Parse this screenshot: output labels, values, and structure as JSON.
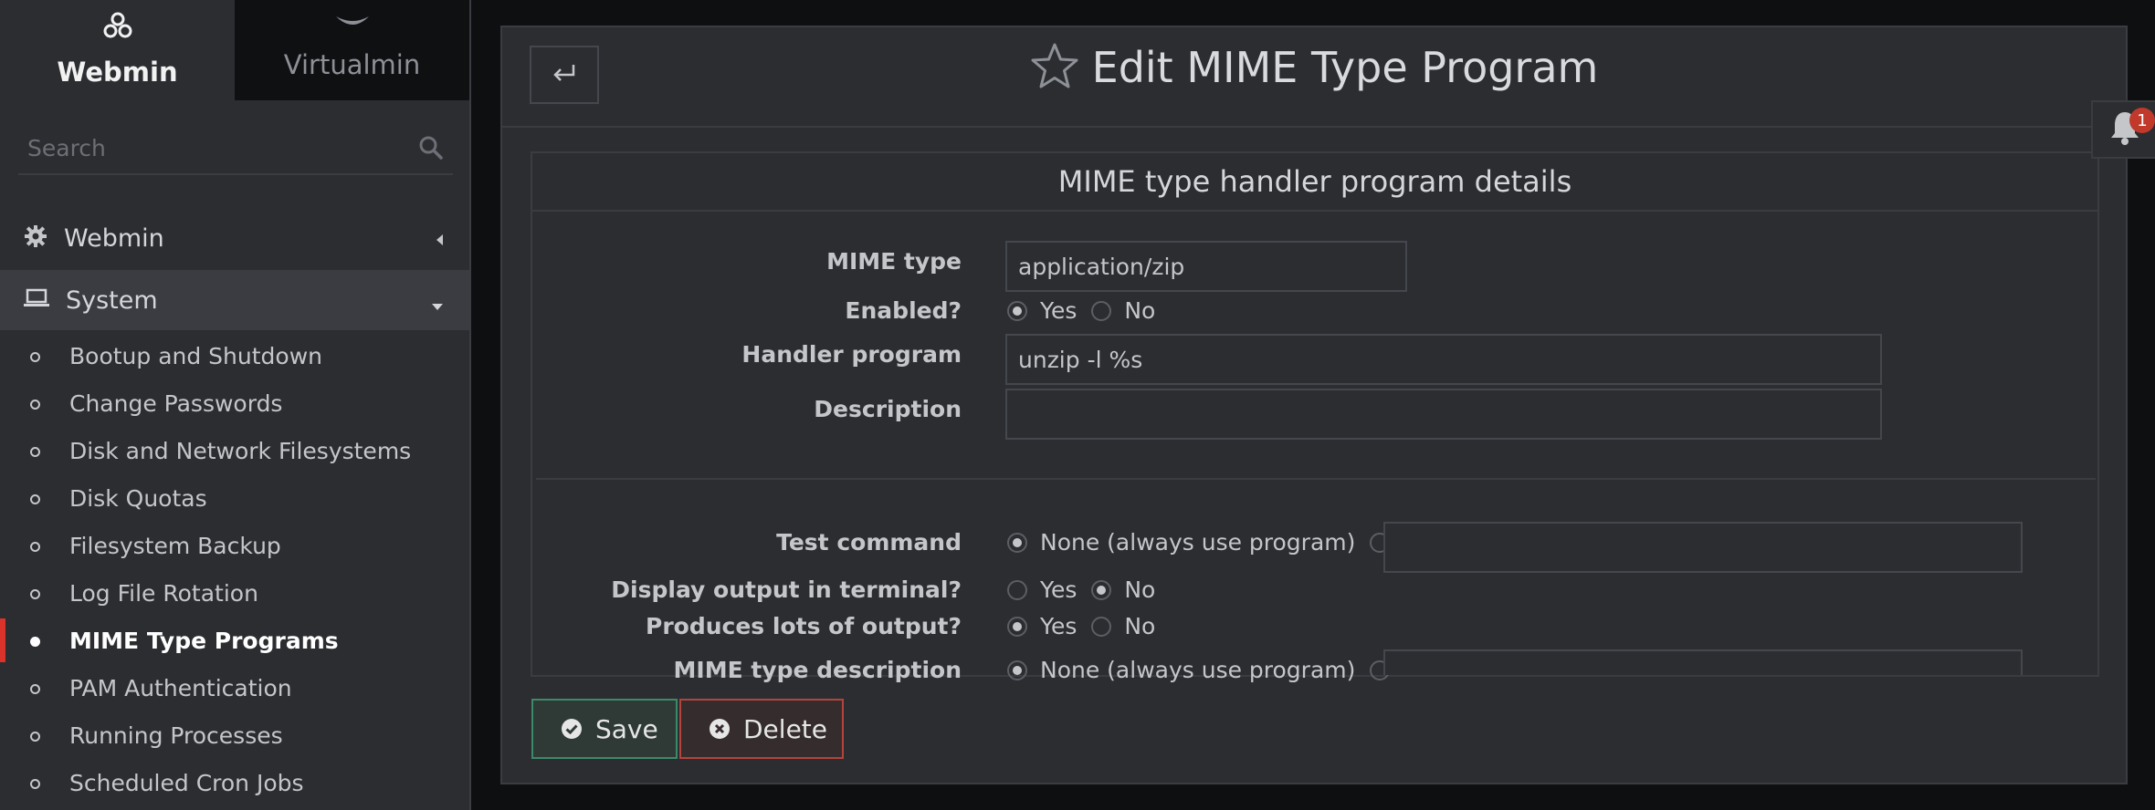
{
  "top_tabs": {
    "webmin": "Webmin",
    "virtualmin": "Virtualmin"
  },
  "search": {
    "placeholder": "Search"
  },
  "categories": {
    "webmin": "Webmin",
    "system": "System"
  },
  "menu": [
    {
      "label": "Bootup and Shutdown",
      "active": false
    },
    {
      "label": "Change Passwords",
      "active": false
    },
    {
      "label": "Disk and Network Filesystems",
      "active": false
    },
    {
      "label": "Disk Quotas",
      "active": false
    },
    {
      "label": "Filesystem Backup",
      "active": false
    },
    {
      "label": "Log File Rotation",
      "active": false
    },
    {
      "label": "MIME Type Programs",
      "active": true
    },
    {
      "label": "PAM Authentication",
      "active": false
    },
    {
      "label": "Running Processes",
      "active": false
    },
    {
      "label": "Scheduled Cron Jobs",
      "active": false
    }
  ],
  "page": {
    "title": "Edit MIME Type Program"
  },
  "form": {
    "heading": "MIME type handler program details",
    "mime_type": {
      "label": "MIME type",
      "value": "application/zip"
    },
    "enabled": {
      "label": "Enabled?",
      "yes": "Yes",
      "no": "No",
      "selected": "yes"
    },
    "handler": {
      "label": "Handler program",
      "value": "unzip -l %s"
    },
    "description": {
      "label": "Description",
      "value": ""
    },
    "test_command": {
      "label": "Test command",
      "none_label": "None (always use program)",
      "selected": "none",
      "value": ""
    },
    "display_terminal": {
      "label": "Display output in terminal?",
      "yes": "Yes",
      "no": "No",
      "selected": "no"
    },
    "lots_output": {
      "label": "Produces lots of output?",
      "yes": "Yes",
      "no": "No",
      "selected": "yes"
    },
    "mime_desc": {
      "label": "MIME type description",
      "none_label": "None (always use program)",
      "selected": "none",
      "value": ""
    }
  },
  "buttons": {
    "save": "Save",
    "delete": "Delete"
  },
  "notifications": {
    "count": "1"
  },
  "colors": {
    "accent_active": "#d9332b",
    "save_border": "#3d8a6a",
    "delete_border": "#b4443b",
    "badge": "#c0392b"
  }
}
